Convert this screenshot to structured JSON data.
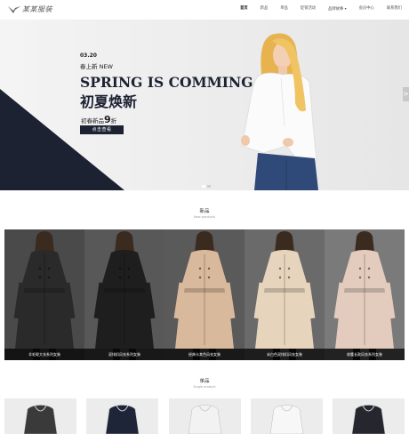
{
  "header": {
    "logo_text": "某某服装",
    "nav": [
      "首页",
      "新品",
      "单品",
      "促销活动",
      "品牌故事",
      "会员中心",
      "联系我们"
    ],
    "nav_dropdown_index": 4,
    "active_index": 0
  },
  "banner": {
    "date": "03.20",
    "new_line": "春上新 NEW",
    "headline": "SPRING IS COMMING",
    "sub_title": "初夏焕新",
    "promo_prefix": "初春新品",
    "promo_number": "9",
    "promo_suffix": "折",
    "button": "点击查看",
    "next_arrow": ">"
  },
  "new_section": {
    "title": "新品",
    "subtitle": "New products"
  },
  "products": [
    {
      "caption": "羊毛呢大衣系列女装",
      "coat_color": "#2a2a2a",
      "bg": "#4a4a4a"
    },
    {
      "caption": "双排扣风衣系列女装",
      "coat_color": "#1e1e1e",
      "bg": "#585858"
    },
    {
      "caption": "经典卡其色风衣女装",
      "coat_color": "#d9b99b",
      "bg": "#5a5a5a"
    },
    {
      "caption": "米白色双排扣风衣女装",
      "coat_color": "#e6d4bd",
      "bg": "#6a6a6a"
    },
    {
      "caption": "收腰长款风衣系列女装",
      "coat_color": "#e3ccbd",
      "bg": "#7a7a7a"
    }
  ],
  "single_section": {
    "title": "单品",
    "subtitle": "Single product"
  },
  "singles_colors": [
    "#3a3a3a",
    "#1f2538",
    "#f2f2f2",
    "#f7f7f7",
    "#26262e"
  ],
  "colors": {
    "navy": "#1d2233",
    "banner_bg": "#ececec"
  }
}
